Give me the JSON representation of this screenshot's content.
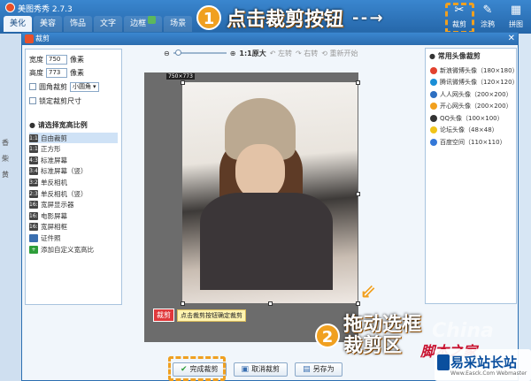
{
  "app": {
    "title": "美图秀秀 2.7.3"
  },
  "tabs": [
    {
      "label": "美化",
      "active": true
    },
    {
      "label": "美容",
      "active": false
    },
    {
      "label": "饰品",
      "active": false
    },
    {
      "label": "文字",
      "active": false
    },
    {
      "label": "边框",
      "active": false
    },
    {
      "label": "场景",
      "active": false
    }
  ],
  "toolbar_icons": [
    {
      "label": "裁剪",
      "icon": "scissors-icon"
    },
    {
      "label": "涂鸦",
      "icon": "pen-icon"
    },
    {
      "label": "拼图",
      "icon": "puzzle-icon"
    }
  ],
  "step1": {
    "num": "1",
    "text": "点击裁剪按钮",
    "arrow": "- - →"
  },
  "background_left": [
    "香",
    "柴",
    "黄"
  ],
  "dialog": {
    "title": "裁剪",
    "close": "✕",
    "width_label": "宽度",
    "width_value": "750",
    "width_unit": "像素",
    "height_label": "高度",
    "height_value": "773",
    "height_unit": "像素",
    "round_label": "圆角裁剪",
    "round_select": "小圆角",
    "lock_label": "锁定裁剪尺寸",
    "ratio_head": "请选择宽高比例",
    "ratios": [
      {
        "badge": "1:1",
        "label": "自由裁剪",
        "selected": true
      },
      {
        "badge": "1:1",
        "label": "正方形",
        "selected": false
      },
      {
        "badge": "4:3",
        "label": "标准屏幕",
        "selected": false
      },
      {
        "badge": "3:4",
        "label": "标准屏幕（竖）",
        "selected": false
      },
      {
        "badge": "3:2",
        "label": "单反相机",
        "selected": false
      },
      {
        "badge": "2:3",
        "label": "单反相机（竖）",
        "selected": false
      },
      {
        "badge": "16:9",
        "label": "宽屏显示器",
        "selected": false
      },
      {
        "badge": "16:9",
        "label": "电影屏幕",
        "selected": false
      },
      {
        "badge": "16:10",
        "label": "宽屏相框",
        "selected": false
      },
      {
        "badge": "",
        "label": "证件照",
        "selected": false
      },
      {
        "badge": "+",
        "label": "添加自定义宽高比",
        "selected": false
      }
    ],
    "zoom": {
      "ratio": "1:1原大",
      "rotate_left": "左转",
      "rotate_right": "右转",
      "reset": "重新开始"
    },
    "size_tag": "750×773",
    "crop_label": "裁剪",
    "hint": "点击裁剪按钮确定裁剪",
    "presets_head": "常用头像裁剪",
    "presets": [
      {
        "label": "新浪微博头像（180×180）",
        "color": "#e2412e"
      },
      {
        "label": "腾讯微博头像（120×120）",
        "color": "#1a8ed6"
      },
      {
        "label": "人人网头像（200×200）",
        "color": "#2d6fc1"
      },
      {
        "label": "开心网头像（200×200）",
        "color": "#f2a01d"
      },
      {
        "label": "QQ头像（100×100）",
        "color": "#333333"
      },
      {
        "label": "论坛头像（48×48）",
        "color": "#f0c419"
      },
      {
        "label": "百度空间（110×110）",
        "color": "#3478d8"
      }
    ],
    "buttons": {
      "done": "完成裁剪",
      "cancel": "取消裁剪",
      "save": "另存为"
    }
  },
  "step2": {
    "num": "2",
    "text": "拖动选框裁剪区"
  },
  "watermark": {
    "cn": "China",
    "red": "脚本之家",
    "logo_title": "易采站长站",
    "logo_sub": "Www.Easck.Com  Webmaster"
  }
}
